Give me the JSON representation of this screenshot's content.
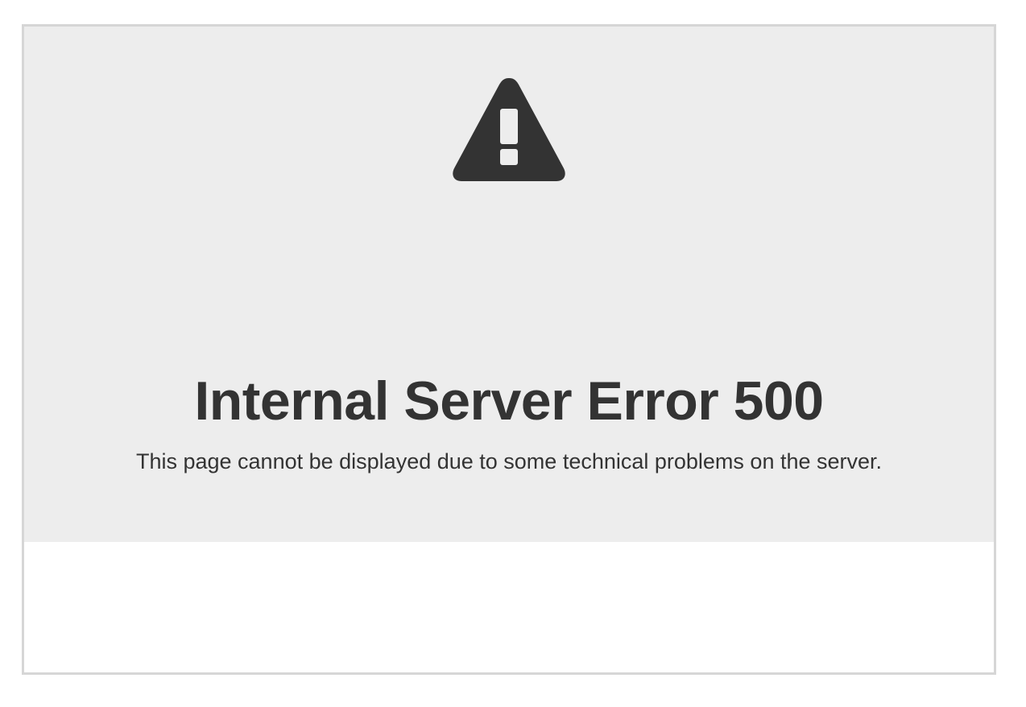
{
  "error": {
    "icon": "warning-triangle-icon",
    "title": "Internal Server Error 500",
    "message": "This page cannot be displayed due to some technical problems on the server."
  },
  "colors": {
    "panel_background": "#ededed",
    "text": "#333333",
    "border": "#d6d6d6",
    "page_background": "#ffffff"
  }
}
